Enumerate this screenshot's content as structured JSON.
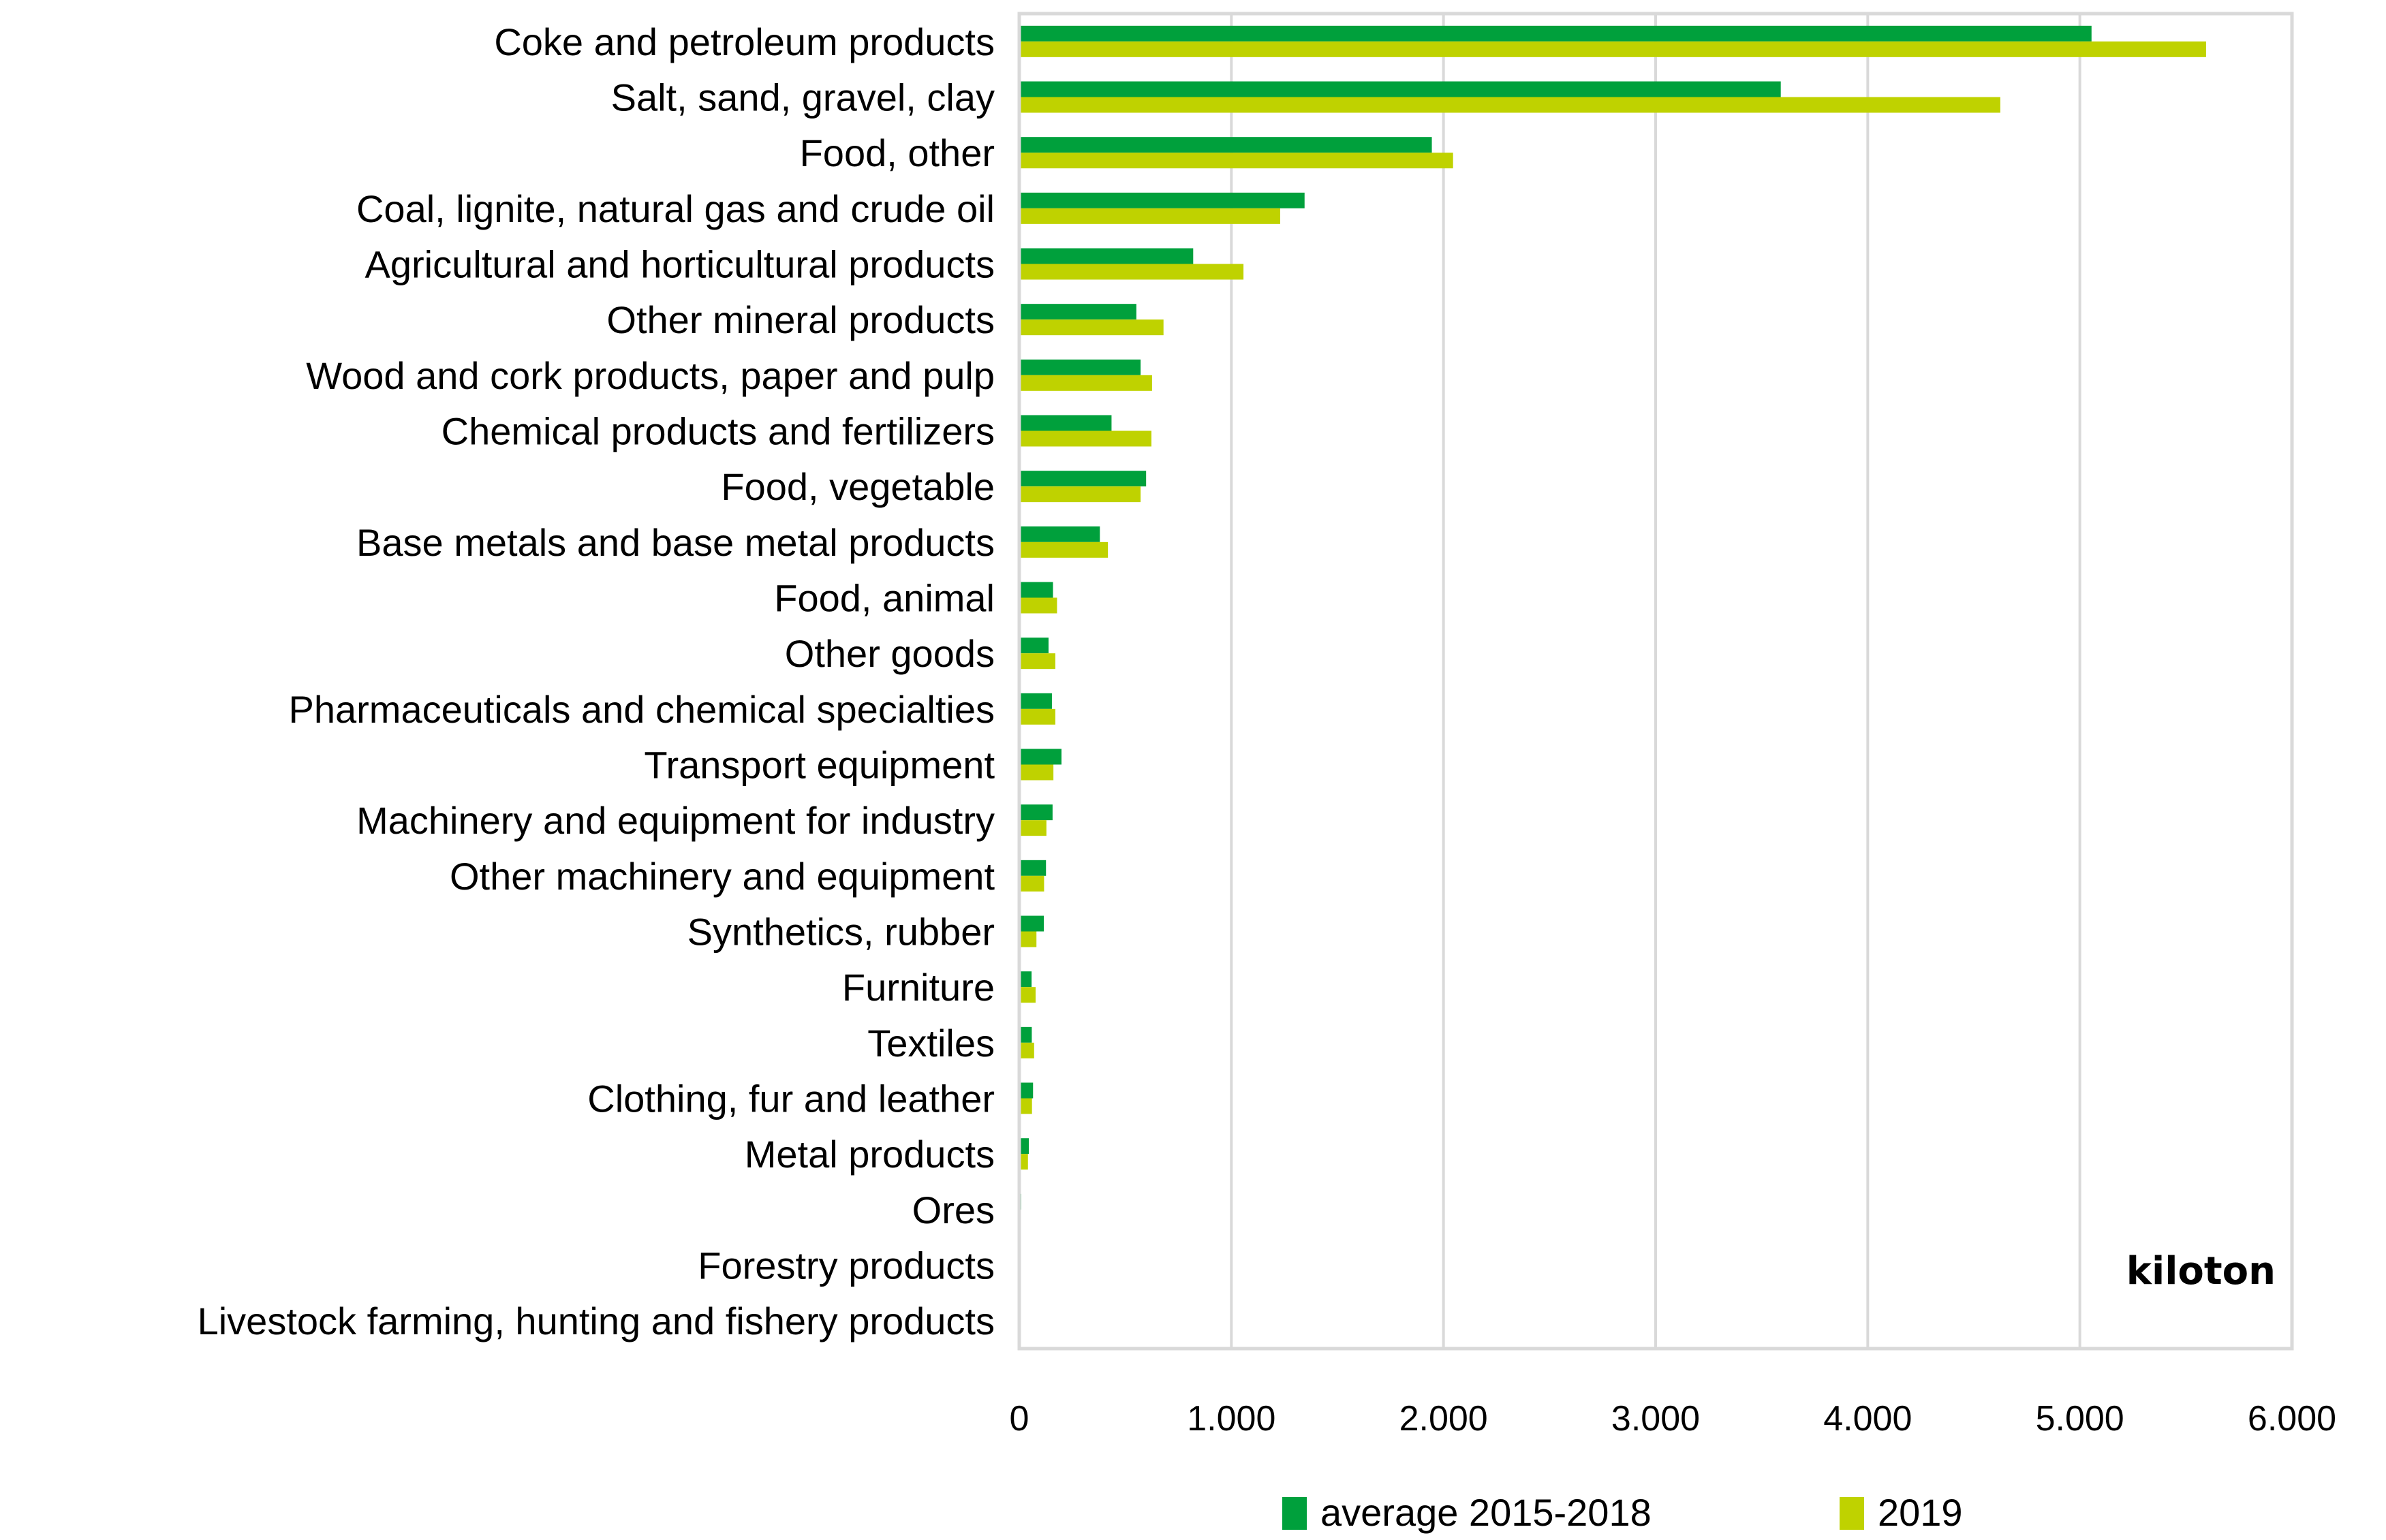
{
  "chart_data": {
    "type": "bar",
    "orientation": "horizontal",
    "title": "",
    "xlabel": "",
    "ylabel": "",
    "unit_label": "kiloton",
    "xlim": [
      0,
      6000
    ],
    "x_ticks": [
      0,
      1000,
      2000,
      3000,
      4000,
      5000,
      6000
    ],
    "x_tick_labels": [
      "0",
      "1.000",
      "2.000",
      "3.000",
      "4.000",
      "5.000",
      "6.000"
    ],
    "grid": true,
    "legend_position": "bottom",
    "categories": [
      "Coke and petroleum products",
      "Salt, sand, gravel, clay",
      "Food, other",
      "Coal, lignite, natural gas and crude oil",
      "Agricultural and horticultural products",
      "Other mineral products",
      "Wood and cork products, paper and pulp",
      "Chemical products and fertilizers",
      "Food, vegetable",
      "Base metals and base metal products",
      "Food, animal",
      "Other goods",
      "Pharmaceuticals and chemical specialties",
      "Transport equipment",
      "Machinery and equipment for industry",
      "Other machinery and equipment",
      "Synthetics, rubber",
      "Furniture",
      "Textiles",
      "Clothing, fur and leather",
      "Metal products",
      "Ores",
      "Forestry products",
      "Livestock farming, hunting and fishery products"
    ],
    "series": [
      {
        "name": "average 2015-2018",
        "color": "#00a03c",
        "values": [
          5055,
          3590,
          1945,
          1345,
          820,
          552,
          572,
          435,
          598,
          380,
          159,
          138,
          154,
          199,
          157,
          126,
          116,
          58,
          59,
          65,
          45,
          9,
          3,
          8
        ]
      },
      {
        "name": "2019",
        "color": "#bfd200",
        "values": [
          5595,
          4625,
          2045,
          1230,
          1057,
          680,
          626,
          623,
          572,
          418,
          178,
          170,
          170,
          161,
          128,
          117,
          81,
          77,
          70,
          60,
          41,
          8,
          0,
          1
        ]
      }
    ]
  }
}
